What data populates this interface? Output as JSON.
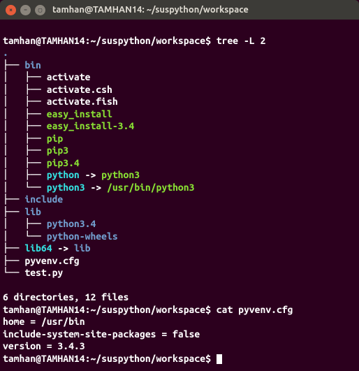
{
  "window": {
    "title": "tamhan@TAMHAN14: ~/suspython/workspace"
  },
  "prompt": "tamhan@TAMHAN14:~/suspython/workspace$",
  "cmd1": "tree -L 2",
  "treeRoot": ".",
  "tree": {
    "l1": "├── ",
    "l1c": "bin",
    "l2": "│   ├── ",
    "l2c": "activate",
    "l3": "│   ├── ",
    "l3c": "activate.csh",
    "l4": "│   ├── ",
    "l4c": "activate.fish",
    "l5": "│   ├── ",
    "l5c": "easy_install",
    "l6": "│   ├── ",
    "l6c": "easy_install-3.4",
    "l7": "│   ├── ",
    "l7c": "pip",
    "l8": "│   ├── ",
    "l8c": "pip3",
    "l9": "│   ├── ",
    "l9c": "pip3.4",
    "l10": "│   ├── ",
    "l10c": "python",
    "l10a": " -> ",
    "l10t": "python3",
    "l11": "│   └── ",
    "l11c": "python3",
    "l11a": " -> ",
    "l11t": "/usr/bin/python3",
    "l12": "├── ",
    "l12c": "include",
    "l13": "├── ",
    "l13c": "lib",
    "l14": "│   ├── ",
    "l14c": "python3.4",
    "l15": "│   └── ",
    "l15c": "python-wheels",
    "l16": "├── ",
    "l16c": "lib64",
    "l16a": " -> ",
    "l16t": "lib",
    "l17": "├── ",
    "l17c": "pyvenv.cfg",
    "l18": "└── ",
    "l18c": "test.py"
  },
  "summary": "6 directories, 12 files",
  "cmd2": "cat pyvenv.cfg",
  "cfg": {
    "l1": "home = /usr/bin",
    "l2": "include-system-site-packages = false",
    "l3": "version = 3.4.3"
  }
}
